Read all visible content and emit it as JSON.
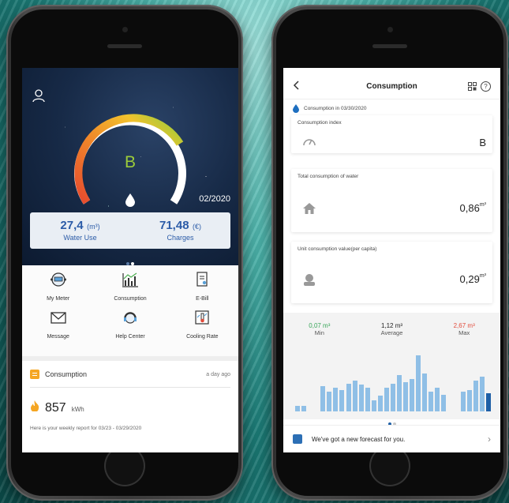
{
  "left": {
    "grade": "B",
    "date": "02/2020",
    "stats": [
      {
        "value": "27,4",
        "unit": "(m³)",
        "label": "Water Use"
      },
      {
        "value": "71,48",
        "unit": "(€)",
        "label": "Charges"
      }
    ],
    "menu": [
      "My Meter",
      "Consumption",
      "E-Bill",
      "Message",
      "Help Center",
      "Cooling Rate"
    ],
    "consumption": {
      "title": "Consumption",
      "time": "a day ago",
      "value": "857",
      "unit": "kWh",
      "report": "Here is your weekly report for 03/23 - 03/29/2020"
    },
    "colors": {
      "gauge_low": "#e64a2e",
      "gauge_mid": "#f2c22d",
      "gauge_high": "#8ccf3c",
      "accent": "#2c5ca8"
    }
  },
  "right": {
    "title": "Consumption",
    "consumption_date": "Consumption in 03/30/2020",
    "cards": [
      {
        "label": "Consumption index",
        "value": "B",
        "icon": "gauge-icon"
      },
      {
        "label": "Total consumption of water",
        "value": "0,86",
        "sup": "m³",
        "icon": "house-icon"
      },
      {
        "label": "Unit consumption value(per capita)",
        "value": "0,29",
        "sup": "m³",
        "icon": "person-icon"
      }
    ],
    "summary": [
      {
        "value": "0,07 m³",
        "label": "Min",
        "color": "#3aa65a"
      },
      {
        "value": "1,12 m³",
        "label": "Average",
        "color": "#222222"
      },
      {
        "value": "2,67 m³",
        "label": "Max",
        "color": "#e24c3c"
      }
    ],
    "forecast": "We've got a new forecast for you."
  },
  "chart_data": {
    "type": "bar",
    "values": [
      0.2,
      0.2,
      0,
      0,
      0.9,
      0.7,
      0.85,
      0.75,
      1.0,
      1.1,
      0.95,
      0.85,
      0.4,
      0.55,
      0.85,
      1.0,
      1.3,
      1.05,
      1.15,
      2.0,
      1.35,
      0.7,
      0.85,
      0.6,
      0,
      0,
      0.7,
      0.75,
      1.1,
      1.25,
      0.65
    ],
    "ylim": [
      0,
      2.2
    ],
    "highlight_last": true
  }
}
